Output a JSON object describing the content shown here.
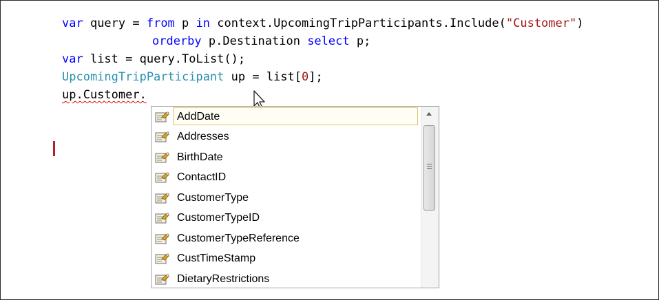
{
  "code": {
    "line1": {
      "kw_var": "var",
      "t1": " query = ",
      "kw_from": "from",
      "t2": " p ",
      "kw_in": "in",
      "t3": " context.UpcomingTripParticipants.Include(",
      "str": "\"Customer\"",
      "t4": ")"
    },
    "line2": {
      "kw_orderby": "orderby",
      "t1": " p.Destination ",
      "kw_select": "select",
      "t2": " p;"
    },
    "line3": {
      "kw_var": "var",
      "t1": " list = query.ToList();"
    },
    "line4": {
      "type": "UpcomingTripParticipant",
      "t1": " up = list[",
      "num": "0",
      "t2": "];"
    },
    "line5": {
      "text": "up.Customer."
    }
  },
  "watermark": "©",
  "completion_list": {
    "items": [
      {
        "label": "AddDate",
        "selected": true
      },
      {
        "label": "Addresses"
      },
      {
        "label": "BirthDate"
      },
      {
        "label": "ContactID"
      },
      {
        "label": "CustomerType"
      },
      {
        "label": "CustomerTypeID"
      },
      {
        "label": "CustomerTypeReference"
      },
      {
        "label": "CustTimeStamp"
      },
      {
        "label": "DietaryRestrictions"
      }
    ],
    "icon": "property-icon",
    "scroll_position": 0.0
  },
  "colors": {
    "keyword": "#0000ff",
    "type": "#2b91af",
    "string": "#a31515",
    "selection_border": "#e5c365",
    "error_squiggle": "#e01010"
  }
}
